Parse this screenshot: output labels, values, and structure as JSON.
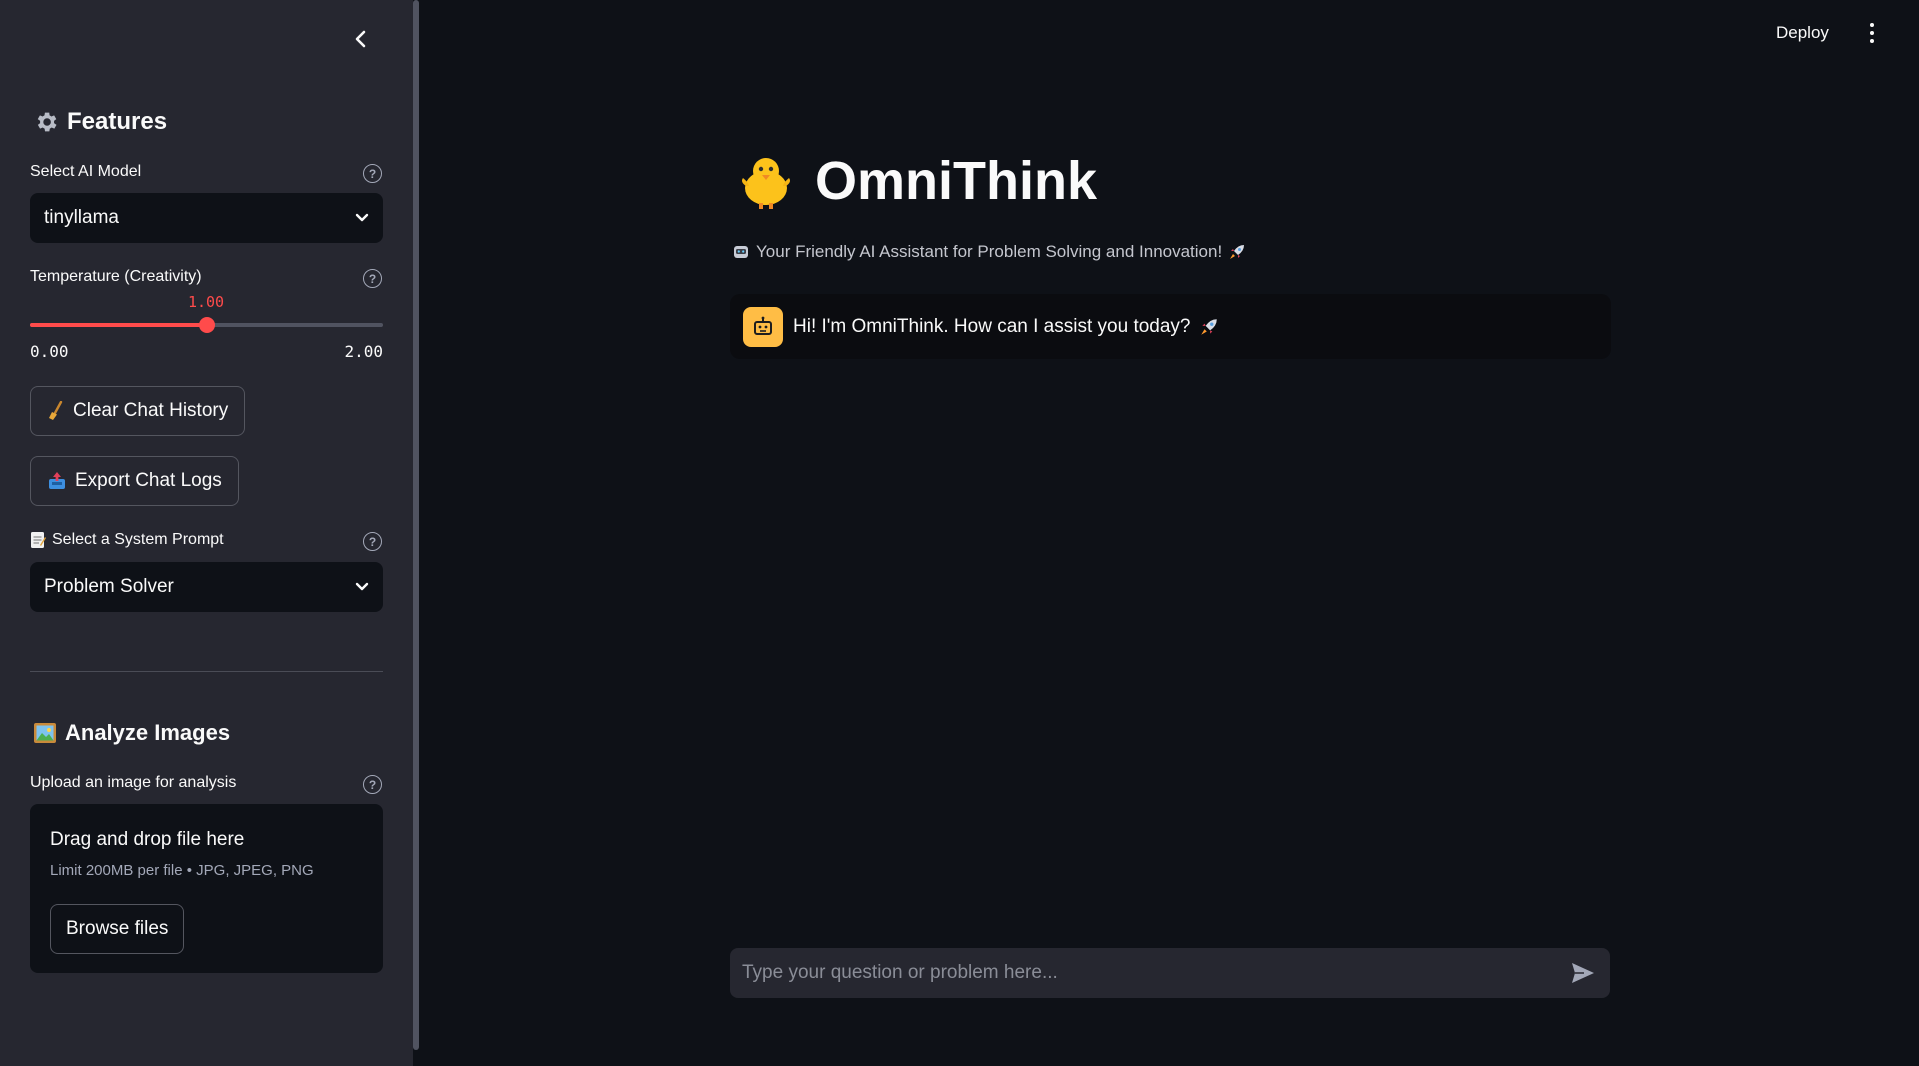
{
  "header": {
    "deploy_label": "Deploy"
  },
  "sidebar": {
    "features_title": "Features",
    "model": {
      "label": "Select AI Model",
      "selected": "tinyllama"
    },
    "temperature": {
      "label": "Temperature (Creativity)",
      "value": 1.0,
      "value_label": "1.00",
      "min_label": "0.00",
      "max_label": "2.00",
      "min": 0,
      "max": 2
    },
    "clear_chat_label": "Clear Chat History",
    "export_logs_label": "Export Chat Logs",
    "system_prompt": {
      "label": "Select a System Prompt",
      "selected": "Problem Solver"
    },
    "analyze_title": "Analyze Images",
    "uploader": {
      "label": "Upload an image for analysis",
      "drop_text": "Drag and drop file here",
      "limit_text": "Limit 200MB per file • JPG, JPEG, PNG",
      "browse_label": "Browse files"
    }
  },
  "main": {
    "title": "OmniThink",
    "subtitle": "Your Friendly AI Assistant for Problem Solving and Innovation!",
    "messages": [
      {
        "role": "assistant",
        "text": "Hi! I'm OmniThink. How can I assist you today?"
      }
    ],
    "input_placeholder": "Type your question or problem here..."
  },
  "colors": {
    "background": "#0e1117",
    "sidebar": "#262730",
    "accent": "#ff4b4b",
    "avatar": "#ffbd45"
  }
}
